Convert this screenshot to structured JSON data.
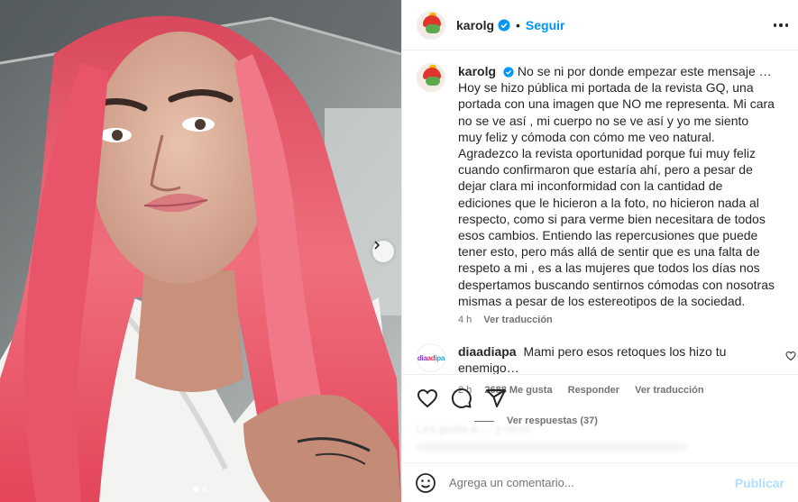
{
  "post": {
    "username": "karolg",
    "follow_label": "Seguir",
    "separator": "•",
    "image_dots": {
      "count": 2,
      "active_index": 0
    }
  },
  "caption": {
    "username": "karolg",
    "text": "No se ni por donde empezar este mensaje … Hoy se hizo pública mi portada de la revista GQ, una portada con una imagen que NO me representa. Mi cara no se ve así , mi cuerpo no se ve así y yo me siento muy feliz y cómoda con cómo me veo natural. Agradezco la revista oportunidad porque fui muy feliz cuando confirmaron que estaría ahí, pero a pesar de dejar clara mi inconformidad con la cantidad de ediciones que le hicieron a la foto, no hicieron nada al respecto, como si para verme bien necesitara de todos esos cambios. Entiendo las repercusiones que puede tener esto, pero más allá de sentir que es una falta de respeto a mi , es a las mujeres que todos los días nos despertamos buscando sentirnos cómodas con nosotras mismas a pesar de los estereotipos de la sociedad.",
    "time": "4 h",
    "translate_label": "Ver traducción"
  },
  "comment": {
    "avatar_text": [
      "dia",
      "ad",
      "ipa"
    ],
    "username": "diaadiapa",
    "text": "Mami pero esos retoques los hizo tu enemigo…",
    "time": "2 h",
    "likes": "2688 Me gusta",
    "reply_label": "Responder",
    "translate_label": "Ver traducción",
    "replies_label": "Ver respuestas (37)"
  },
  "actions": {
    "icons": [
      "heart-icon",
      "comment-icon",
      "share-icon"
    ],
    "blurred_text": "Les gusta a … y otros"
  },
  "add_comment": {
    "placeholder": "Agrega un comentario...",
    "post_label": "Publicar"
  },
  "colors": {
    "accent": "#0095f6",
    "verified": "#0095f6",
    "post_disabled": "#b2dffc",
    "hair": "#e85a6a",
    "text": "#262626",
    "muted": "#737373"
  }
}
